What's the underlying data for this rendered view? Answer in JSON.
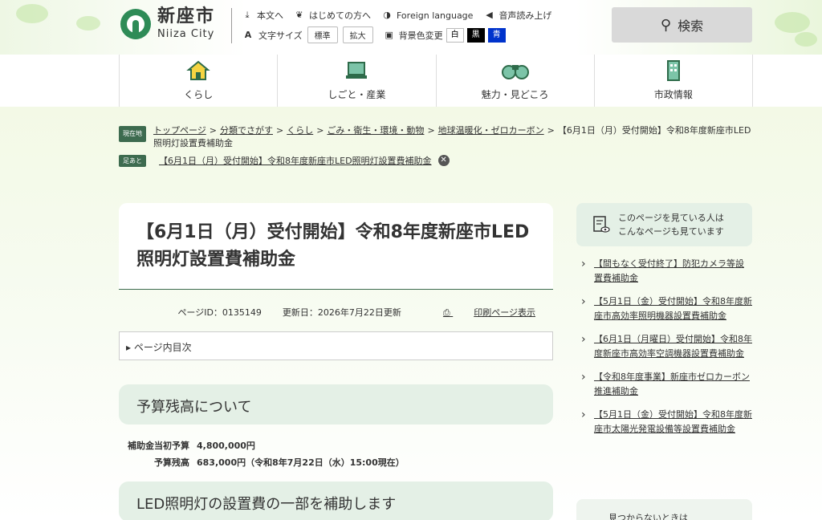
{
  "header": {
    "logo_ja": "新座市",
    "logo_en": "Niiza City",
    "links": [
      {
        "label": "本文へ",
        "icon": "download-icon"
      },
      {
        "label": "はじめての方へ",
        "icon": "leaf-icon"
      },
      {
        "label": "Foreign language",
        "icon": "globe-icon"
      },
      {
        "label": "音声読み上げ",
        "icon": "speaker-icon"
      }
    ],
    "font_size_label": "文字サイズ",
    "font_size_buttons": [
      "標準",
      "拡大"
    ],
    "bg_color_label": "背景色変更",
    "bg_color_buttons": [
      "白",
      "黒",
      "青"
    ],
    "search_label": "検索"
  },
  "nav": {
    "items": [
      {
        "label": "くらし",
        "icon": "house-icon"
      },
      {
        "label": "しごと・産業",
        "icon": "laptop-icon"
      },
      {
        "label": "魅力・見どころ",
        "icon": "binoculars-icon"
      },
      {
        "label": "市政情報",
        "icon": "building-icon"
      }
    ]
  },
  "breadcrumb": {
    "tag": "現在地",
    "items": [
      "トップページ",
      "分類でさがす",
      "くらし",
      "ごみ・衛生・環境・動物",
      "地球温暖化・ゼロカーボン"
    ],
    "current": "【6月1日（月）受付開始】令和8年度新座市LED照明灯設置費補助金"
  },
  "footmark": {
    "tag": "足あと",
    "link": "【6月1日（月）受付開始】令和8年度新座市LED照明灯設置費補助金"
  },
  "page": {
    "title": "【6月1日（月）受付開始】令和8年度新座市LED照明灯設置費補助金",
    "page_id": "ページID：0135149",
    "updated": "更新日：2026年7月22日更新",
    "print": "印刷ページ表示",
    "toc": "ページ内目次",
    "section1": "予算残高について",
    "budget": [
      {
        "label": "補助金当初予算",
        "value": "4,800,000円"
      },
      {
        "label": "予算残高",
        "value": "683,000円（令和8年7月22日（水）15:00現在）"
      }
    ],
    "section2": "LED照明灯の設置費の一部を補助します"
  },
  "sidebar": {
    "heading": "このページを見ている人は\nこんなページも見ています",
    "items": [
      "【間もなく受付終了】防犯カメラ等設置費補助金",
      "【5月1日（金）受付開始】令和8年度新座市高効率照明機器設置費補助金",
      "【6月1日（月曜日）受付開始】令和8年度新座市高効率空調機器設置費補助金",
      "【令和8年度事業】新座市ゼロカーボン推進補助金",
      "【5月1日（金）受付開始】令和8年度新座市太陽光発電設備等設置費補助金"
    ],
    "heading2": "見つからないときは"
  },
  "colors": {
    "accent": "#3d6b4f",
    "section_bg": "#e4f0e6",
    "search_bg": "#d9d9d9"
  }
}
